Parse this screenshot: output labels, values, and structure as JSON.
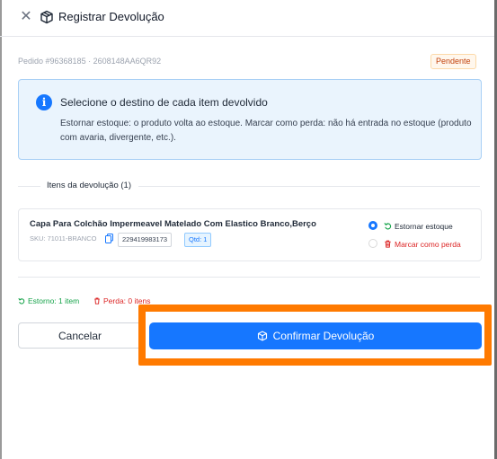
{
  "header": {
    "title": "Registrar Devolução"
  },
  "order": {
    "id_text": "Pedido #96368185 · 2608148AA6QR92",
    "status": "Pendente",
    "status_color": "#c2410c"
  },
  "info": {
    "title": "Selecione o destino de cada item devolvido",
    "description": "Estornar estoque: o produto volta ao estoque. Marcar como perda: não há entrada no estoque (produto com avaria, divergente, etc.).",
    "accent": "#1677ff"
  },
  "section": {
    "title": "Itens da devolução (1)"
  },
  "item": {
    "name": "Capa Para Colchão Impermeavel Matelado Com Elastico Branco,Berço",
    "sku_text": "SKU:  71011-BRANCO",
    "code": "229419983173",
    "qty": "Qtd: 1",
    "options": [
      {
        "label": "Estornar estoque",
        "selected": true,
        "icon": "undo-icon"
      },
      {
        "label": "Marcar como perda",
        "selected": false,
        "icon": "trash-icon"
      }
    ]
  },
  "summary": {
    "returned": "Estorno: 1 item",
    "loss": "Perda: 0 itens"
  },
  "actions": {
    "cancel_label": "Cancelar",
    "confirm_label": "Confirmar Devolução",
    "confirm_color": "#1677ff",
    "highlight_color": "#ff7a00"
  }
}
